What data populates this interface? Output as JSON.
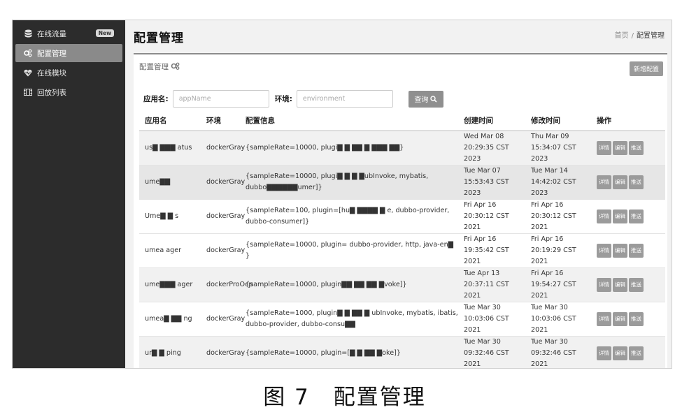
{
  "sidebar": {
    "items": [
      {
        "label": "在线流量",
        "badge": "New",
        "icon": "database-icon"
      },
      {
        "label": "配置管理",
        "icon": "gears-icon"
      },
      {
        "label": "在线模块",
        "icon": "heartbeat-icon"
      },
      {
        "label": "回放列表",
        "icon": "film-icon"
      }
    ]
  },
  "header": {
    "title": "配置管理",
    "breadcrumb": {
      "home": "首页",
      "sep": "/",
      "current": "配置管理"
    }
  },
  "panel": {
    "title": "配置管理",
    "add_button": "新增配置"
  },
  "search": {
    "app_label": "应用名:",
    "app_placeholder": "appName",
    "env_label": "环境:",
    "env_placeholder": "environment",
    "button": "查询"
  },
  "table": {
    "columns": [
      "应用名",
      "环境",
      "配置信息",
      "创建时间",
      "修改时间",
      "操作"
    ],
    "actions": [
      "详情",
      "编辑",
      "推送"
    ],
    "rows": [
      {
        "app": "us▇ ▇▇▇ atus",
        "env": "dockerGray",
        "config": "{sampleRate=10000, plugi▇ ▇ ▇▇ ▇ ▇▇▇ ▇▇}",
        "created": "Wed Mar 08 20:29:35 CST 2023",
        "modified": "Thu Mar 09 15:34:07 CST 2023"
      },
      {
        "app": "ume▇▇",
        "env": "dockerGray",
        "config": "{sampleRate=10000, plugi▇ ▇ ▇ ▇ubInvoke, mybatis, dubbo▇▇▇▇▇▇umer]}",
        "created": "Tue Mar 07 15:53:43 CST 2023",
        "modified": "Tue Mar 14 14:42:02 CST 2023"
      },
      {
        "app": "Ume▇ ▇ s",
        "env": "dockerGray",
        "config": "{sampleRate=100, plugin=[hu▇ ▇▇▇▇ ▇ e, dubbo-provider, dubbo-consumer]}",
        "created": "Fri Apr 16 20:30:12 CST 2021",
        "modified": "Fri Apr 16 20:30:12 CST 2021"
      },
      {
        "app": "umea ager",
        "env": "dockerGray",
        "config": "{sampleRate=10000, plugin= dubbo-provider, http, java-en▇ }",
        "created": "Fri Apr 16 19:35:42 CST 2021",
        "modified": "Fri Apr 16 20:19:29 CST 2021"
      },
      {
        "app": "ume▇▇▇ ager",
        "env": "dockerProOcp",
        "config": "{sampleRate=10000, plugin▇▇ ▇▇ ▇▇ ▇voke]}",
        "created": "Tue Apr 13 20:37:11 CST 2021",
        "modified": "Fri Apr 16 19:54:27 CST 2021"
      },
      {
        "app": "umea▇ ▇▇ ng",
        "env": "dockerGray",
        "config": "{sampleRate=1000, plugin▇ ▇ ▇▇ ▇ ubInvoke, mybatis, ibatis, dubbo-provider, dubbo-consu▇▇",
        "created": "Tue Mar 30 10:03:06 CST 2021",
        "modified": "Tue Mar 30 10:03:06 CST 2021"
      },
      {
        "app": "ur▇ ▇ ping",
        "env": "dockerGray",
        "config": "{sampleRate=10000, plugin=[▇ ▇ ▇▇ ▇oke]}",
        "created": "Tue Mar 30 09:32:46 CST 2021",
        "modified": "Tue Mar 30 09:32:46 CST 2021"
      }
    ]
  },
  "caption": {
    "figure": "图 7",
    "title": "配置管理"
  }
}
